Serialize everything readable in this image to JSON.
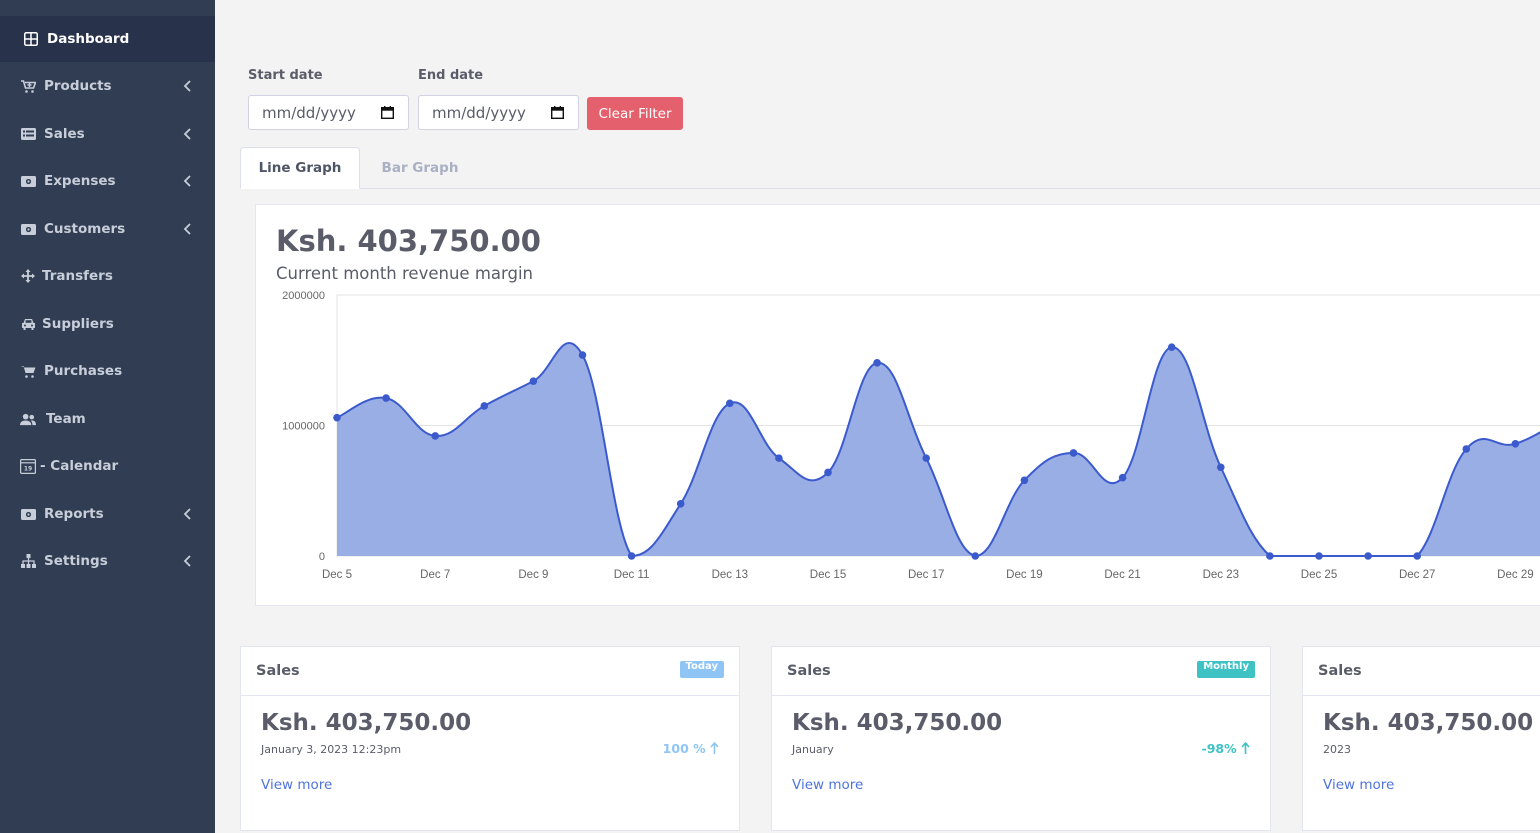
{
  "sidebar": {
    "items": [
      {
        "label": "Dashboard",
        "icon": "grid-icon",
        "active": true,
        "chevron": false
      },
      {
        "label": "Products",
        "icon": "cart-plus-icon",
        "chevron": true
      },
      {
        "label": "Sales",
        "icon": "list-card-icon",
        "chevron": true
      },
      {
        "label": "Expenses",
        "icon": "money-icon",
        "chevron": true
      },
      {
        "label": "Customers",
        "icon": "money-icon",
        "chevron": true
      },
      {
        "label": "Transfers",
        "icon": "arrows-icon",
        "chevron": false
      },
      {
        "label": "Suppliers",
        "icon": "car-icon",
        "chevron": false
      },
      {
        "label": "Purchases",
        "icon": "cart-icon",
        "chevron": false
      },
      {
        "label": "Team",
        "icon": "users-icon",
        "chevron": false
      },
      {
        "label": "- Calendar",
        "icon": "calendar-icon",
        "chevron": false
      },
      {
        "label": "Reports",
        "icon": "money-icon",
        "chevron": true
      },
      {
        "label": "Settings",
        "icon": "sitemap-icon",
        "chevron": true
      }
    ]
  },
  "filter": {
    "start_label": "Start date",
    "end_label": "End date",
    "start_placeholder": "mm/dd/yyyy",
    "end_placeholder": "mm/dd/yyyy",
    "clear_label": "Clear Filter"
  },
  "tabs": {
    "line": "Line Graph",
    "bar": "Bar Graph"
  },
  "chart_card": {
    "amount": "Ksh. 403,750.00",
    "subtitle": "Current month revenue margin"
  },
  "chart_data": {
    "type": "area",
    "x": [
      "Dec 5",
      "Dec 6",
      "Dec 7",
      "Dec 8",
      "Dec 9",
      "Dec 10",
      "Dec 11",
      "Dec 12",
      "Dec 13",
      "Dec 14",
      "Dec 15",
      "Dec 16",
      "Dec 17",
      "Dec 18",
      "Dec 19",
      "Dec 20",
      "Dec 21",
      "Dec 22",
      "Dec 23",
      "Dec 24",
      "Dec 25",
      "Dec 26",
      "Dec 27",
      "Dec 28",
      "Dec 29",
      "Dec 30"
    ],
    "tick_labels": [
      "Dec 5",
      "Dec 7",
      "Dec 9",
      "Dec 11",
      "Dec 13",
      "Dec 15",
      "Dec 17",
      "Dec 19",
      "Dec 21",
      "Dec 23",
      "Dec 25",
      "Dec 27",
      "Dec 29"
    ],
    "values": [
      1060000,
      1210000,
      920000,
      1150000,
      1340000,
      1540000,
      0,
      400000,
      1170000,
      750000,
      640000,
      1480000,
      750000,
      0,
      580000,
      790000,
      600000,
      1600000,
      680000,
      0,
      0,
      0,
      0,
      820000,
      860000,
      1060000
    ],
    "y_ticks": [
      "0",
      "1000000",
      "2000000"
    ],
    "ylim": [
      0,
      2000000
    ],
    "grid": true,
    "fill_color": "#9aaee6",
    "line_color": "#3b5bcd"
  },
  "stats": [
    {
      "title": "Sales",
      "badge": "Today",
      "amount": "Ksh. 403,750.00",
      "date": "January 3, 2023 12:23pm",
      "pct": "100 %",
      "link": "View more"
    },
    {
      "title": "Sales",
      "badge": "Monthly",
      "amount": "Ksh. 403,750.00",
      "date": "January",
      "pct": "-98%",
      "link": "View more"
    },
    {
      "title": "Sales",
      "amount": "Ksh. 403,750.00",
      "date": "2023",
      "link": "View more"
    }
  ]
}
